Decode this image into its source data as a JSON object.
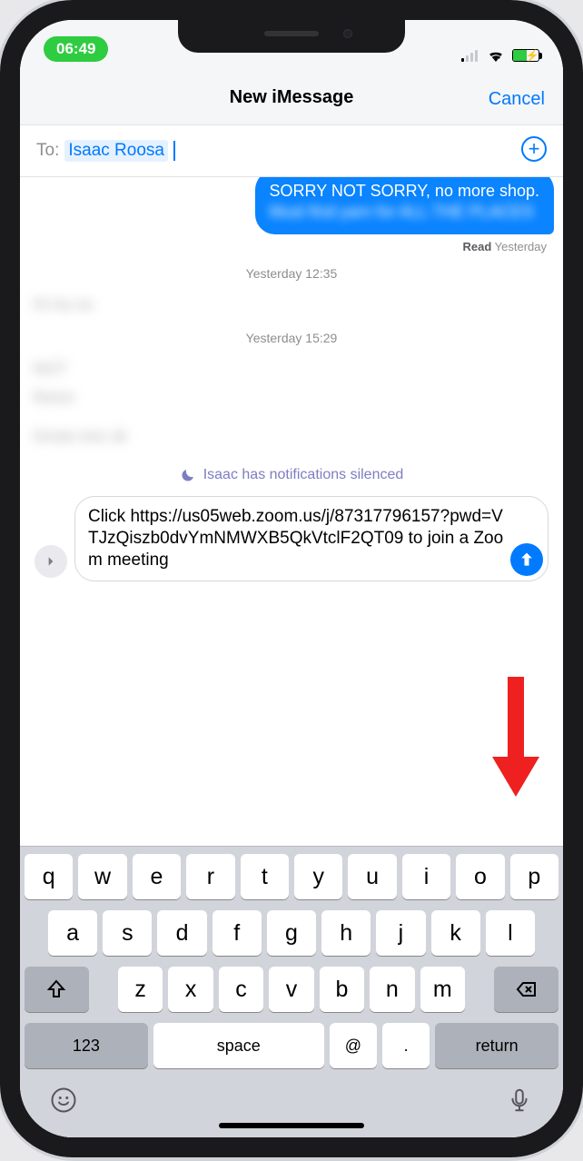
{
  "status": {
    "time": "06:49"
  },
  "nav": {
    "title": "New iMessage",
    "cancel": "Cancel"
  },
  "to": {
    "label": "To:",
    "recipient": "Isaac Roosa"
  },
  "transcript": {
    "out_bubble_line1": "SORRY NOT SORRY, no more shop.",
    "out_bubble_line2": "Must find yarn for ALL THE PLACES",
    "read_label": "Read",
    "read_time": "Yesterday",
    "sep1": "Yesterday 12:35",
    "in1": "Hi ha no",
    "sep2": "Yesterday 15:29",
    "in2a": "NOT",
    "in2b": "Noice",
    "in2c": "Great one ok",
    "silenced": "Isaac has notifications silenced"
  },
  "compose": {
    "text": "Click https://us05web.zoom.us/j/87317796157?pwd=VTJzQiszb0dvYmNMWXB5QkVtclF2QT09 to join a Zoom meeting"
  },
  "keyboard": {
    "row1": [
      "q",
      "w",
      "e",
      "r",
      "t",
      "y",
      "u",
      "i",
      "o",
      "p"
    ],
    "row2": [
      "a",
      "s",
      "d",
      "f",
      "g",
      "h",
      "j",
      "k",
      "l"
    ],
    "row3": [
      "z",
      "x",
      "c",
      "v",
      "b",
      "n",
      "m"
    ],
    "numkey": "123",
    "space": "space",
    "at": "@",
    "dot": ".",
    "return": "return"
  }
}
